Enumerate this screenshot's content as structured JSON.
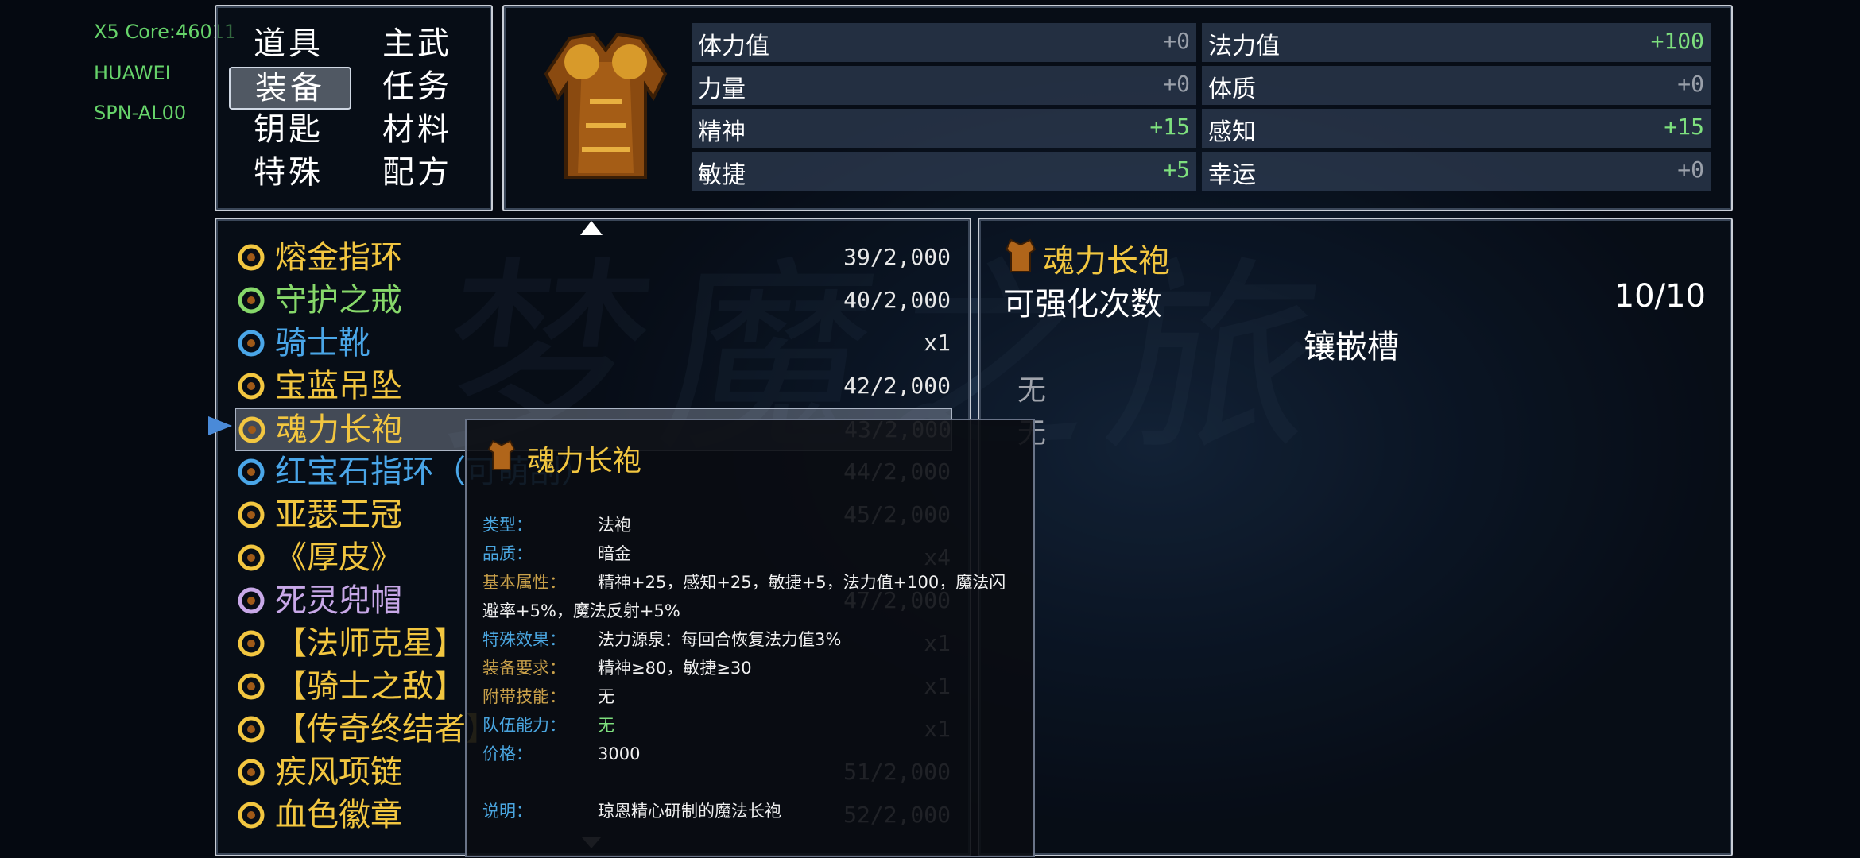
{
  "device": {
    "core": "X5 Core:46011",
    "brand": "HUAWEI",
    "model": "SPN-AL00"
  },
  "watermark": "梦魔之旅",
  "categories": [
    {
      "label": "道具",
      "selected": false
    },
    {
      "label": "主武",
      "selected": false
    },
    {
      "label": "装备",
      "selected": true
    },
    {
      "label": "任务",
      "selected": false
    },
    {
      "label": "钥匙",
      "selected": false
    },
    {
      "label": "材料",
      "selected": false
    },
    {
      "label": "特殊",
      "selected": false
    },
    {
      "label": "配方",
      "selected": false
    }
  ],
  "stats": [
    {
      "label": "体力值",
      "value": "+0"
    },
    {
      "label": "法力值",
      "value": "+100"
    },
    {
      "label": "力量",
      "value": "+0"
    },
    {
      "label": "体质",
      "value": "+0"
    },
    {
      "label": "精神",
      "value": "+15"
    },
    {
      "label": "感知",
      "value": "+15"
    },
    {
      "label": "敏捷",
      "value": "+5"
    },
    {
      "label": "幸运",
      "value": "+0"
    }
  ],
  "items": [
    {
      "name": "熔金指环",
      "count": "39/2,000",
      "color": "#f2c640",
      "icon": "gold-ring-icon"
    },
    {
      "name": "守护之戒",
      "count": "40/2,000",
      "color": "#86d86a",
      "icon": "ring-icon"
    },
    {
      "name": "骑士靴",
      "count": "x1",
      "color": "#4aa6e8",
      "icon": "boots-icon"
    },
    {
      "name": "宝蓝吊坠",
      "count": "42/2,000",
      "color": "#f2c640",
      "icon": "pendant-icon"
    },
    {
      "name": "魂力长袍",
      "count": "43/2,000",
      "color": "#f2c640",
      "icon": "robe-icon"
    },
    {
      "name": "红宝石指环（可萌刮）",
      "count": "44/2,000",
      "color": "#4aa6e8",
      "icon": "ruby-ring-icon"
    },
    {
      "name": "亚瑟王冠",
      "count": "45/2,000",
      "color": "#f2c640",
      "icon": "crown-icon"
    },
    {
      "name": "《厚皮》",
      "count": "x4",
      "color": "#f2c640",
      "icon": "scroll-icon"
    },
    {
      "name": "死灵兜帽",
      "count": "47/2,000",
      "color": "#c8a8e8",
      "icon": "hood-icon"
    },
    {
      "name": "【法师克星】",
      "count": "x1",
      "color": "#f2c640",
      "icon": "skill-book-icon"
    },
    {
      "name": "【骑士之敌】",
      "count": "x1",
      "color": "#f2c640",
      "icon": "skill-book-icon"
    },
    {
      "name": "【传奇终结者】",
      "count": "x1",
      "color": "#f2c640",
      "icon": "skill-book-icon"
    },
    {
      "name": "疾风项链",
      "count": "51/2,000",
      "color": "#f2c640",
      "icon": "necklace-icon"
    },
    {
      "name": "血色徽章",
      "count": "52/2,000",
      "color": "#f2c640",
      "icon": "badge-icon"
    }
  ],
  "detail": {
    "name": "魂力长袍",
    "enhance_label": "可强化次数",
    "enhance_value": "10/10",
    "socket_title": "镶嵌槽",
    "sockets": [
      "无",
      "无"
    ]
  },
  "tooltip": {
    "name": "魂力长袍",
    "rows": [
      {
        "k": "类型：",
        "v": "法袍"
      },
      {
        "k": "品质：",
        "v": "暗金"
      },
      {
        "k": "基本属性：",
        "v": "精神+25，感知+25，敏捷+5，法力值+100，魔法闪"
      },
      {
        "k": "",
        "v": "避率+5%，魔法反射+5%"
      },
      {
        "k": "特殊效果：",
        "v": "法力源泉：每回合恢复法力值3%"
      },
      {
        "k": "装备要求：",
        "v": "精神≥80，敏捷≥30"
      },
      {
        "k": "附带技能：",
        "v": "无"
      },
      {
        "k": "队伍能力：",
        "v": "无"
      },
      {
        "k": "价格：",
        "v": "3000"
      },
      {
        "k": "",
        "v": ""
      },
      {
        "k": "说明：",
        "v": "琼恩精心研制的魔法长袍"
      }
    ]
  }
}
